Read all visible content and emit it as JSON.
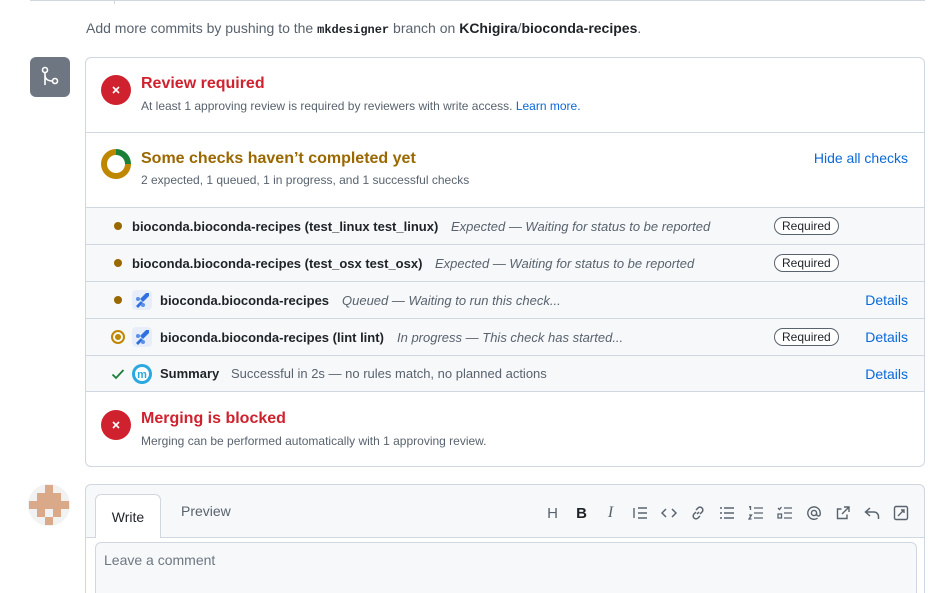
{
  "push_note": {
    "prefix": "Add more commits by pushing to the",
    "branch": "mkdesigner",
    "middle": "branch on",
    "owner": "KChigira",
    "slash": "/",
    "repo": "bioconda-recipes",
    "suffix": "."
  },
  "review": {
    "title": "Review required",
    "subtitle": "At least 1 approving review is required by reviewers with write access.",
    "learn_more": "Learn more."
  },
  "checks": {
    "title": "Some checks haven’t completed yet",
    "subtitle": "2 expected, 1 queued, 1 in progress, and 1 successful checks",
    "hide_label": "Hide all checks",
    "rows": [
      {
        "name": "bioconda.bioconda-recipes (test_linux test_linux)",
        "desc": "Expected — Waiting for status to be reported",
        "required": "Required",
        "details": ""
      },
      {
        "name": "bioconda.bioconda-recipes (test_osx test_osx)",
        "desc": "Expected — Waiting for status to be reported",
        "required": "Required",
        "details": ""
      },
      {
        "name": "bioconda.bioconda-recipes",
        "desc": "Queued — Waiting to run this check...",
        "required": "",
        "details": "Details"
      },
      {
        "name": "bioconda.bioconda-recipes (lint lint)",
        "desc": "In progress — This check has started...",
        "required": "Required",
        "details": "Details"
      },
      {
        "name": "Summary",
        "desc": "Successful in 2s — no rules match, no planned actions",
        "required": "",
        "details": "Details"
      }
    ]
  },
  "blocked": {
    "title": "Merging is blocked",
    "subtitle": "Merging can be performed automatically with 1 approving review."
  },
  "comment": {
    "tab_write": "Write",
    "tab_preview": "Preview",
    "placeholder": "Leave a comment",
    "toolbar": {
      "heading": "H",
      "bold": "B",
      "italic": "I"
    }
  },
  "colors": {
    "danger": "#cf222e",
    "attention": "#9a6700",
    "success": "#1a7f37",
    "accent": "#0969da",
    "azure": "#2f6fe0",
    "mergify": "#2aa8e0"
  }
}
